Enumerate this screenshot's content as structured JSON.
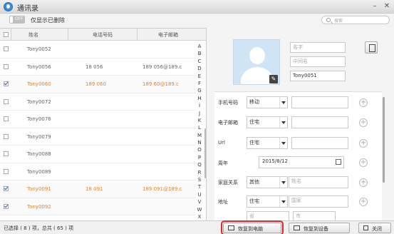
{
  "window": {
    "title": "通讯录"
  },
  "toolbar": {
    "toggle_state": "OFF",
    "toggle_label": "仅显示已删除",
    "search_placeholder": "搜索"
  },
  "table": {
    "columns": [
      "姓名",
      "电话号码",
      "电子邮箱"
    ],
    "rows": [
      {
        "name": "Tony0052",
        "phone": "",
        "email": "",
        "checked": false
      },
      {
        "name": "Tony0056",
        "phone": "18       056",
        "email": "189       056@189.c",
        "checked": false
      },
      {
        "name": "Tony0060",
        "phone": "189       060",
        "email": "189       60@189.c",
        "checked": true
      },
      {
        "name": "Tony0072",
        "phone": "",
        "email": "",
        "checked": false
      },
      {
        "name": "Tony0076",
        "phone": "",
        "email": "",
        "checked": false
      },
      {
        "name": "Tony0079",
        "phone": "",
        "email": "",
        "checked": false
      },
      {
        "name": "Tony0088",
        "phone": "",
        "email": "",
        "checked": false
      },
      {
        "name": "Tony0089",
        "phone": "",
        "email": "",
        "checked": false
      },
      {
        "name": "Tony0091",
        "phone": "18       091",
        "email": "189       091@189.c",
        "checked": true
      },
      {
        "name": "Tony0092",
        "phone": "",
        "email": "",
        "checked": true
      }
    ],
    "alphabet": [
      "A",
      "B",
      "C",
      "D",
      "E",
      "F",
      "G",
      "H",
      "I",
      "J",
      "K",
      "L",
      "M",
      "N",
      "O",
      "P",
      "Q",
      "R",
      "S",
      "T",
      "U",
      "V",
      "W",
      "X",
      "Y",
      "Z"
    ]
  },
  "detail": {
    "name_placeholder": "名字",
    "middle_placeholder": "中间名",
    "last_name_value": "Tony0051",
    "phone": {
      "label": "手机号码",
      "type": "移动"
    },
    "email": {
      "label": "电子邮箱",
      "type": "住宅"
    },
    "url": {
      "label": "Url",
      "type": "住宅"
    },
    "anniversary": {
      "label": "周年",
      "value": "2015/8/12"
    },
    "family": {
      "label": "家庭关系",
      "type": "其他",
      "placeholder": "姓名"
    },
    "address": {
      "label": "地址",
      "type": "住宅",
      "country_placeholder": "国家",
      "province_placeholder": "省",
      "city_placeholder": "市"
    }
  },
  "status": {
    "text": "已选择 ( 8 ) 项，总共 ( 65 ) 项",
    "restore_pc": "恢复到电脑",
    "restore_device": "恢复到设备",
    "close": "关闭"
  }
}
